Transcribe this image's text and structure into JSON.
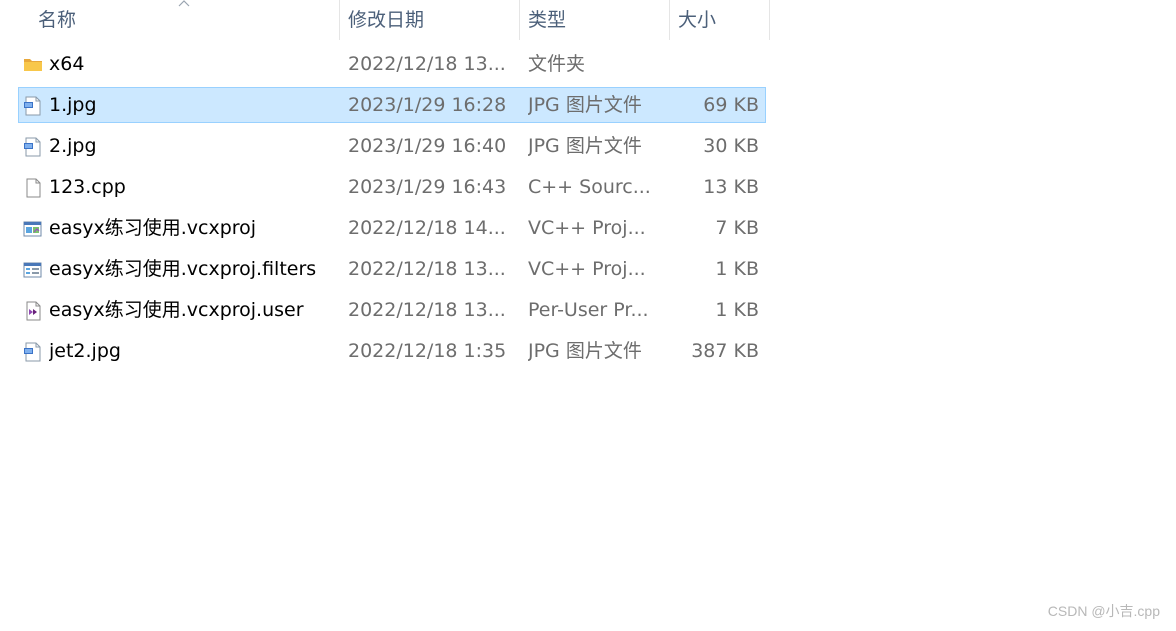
{
  "columns": {
    "name": "名称",
    "date": "修改日期",
    "type": "类型",
    "size": "大小"
  },
  "files": [
    {
      "icon": "folder-icon",
      "name": "x64",
      "date": "2022/12/18 13...",
      "type": "文件夹",
      "size": "",
      "selected": false
    },
    {
      "icon": "jpg-file-icon",
      "name": "1.jpg",
      "date": "2023/1/29 16:28",
      "type": "JPG 图片文件",
      "size": "69 KB",
      "selected": true
    },
    {
      "icon": "jpg-file-icon",
      "name": "2.jpg",
      "date": "2023/1/29 16:40",
      "type": "JPG 图片文件",
      "size": "30 KB",
      "selected": false
    },
    {
      "icon": "blank-file-icon",
      "name": "123.cpp",
      "date": "2023/1/29 16:43",
      "type": "C++ Sourc...",
      "size": "13 KB",
      "selected": false
    },
    {
      "icon": "vcxproj-file-icon",
      "name": "easyx练习使用.vcxproj",
      "date": "2022/12/18 14...",
      "type": "VC++ Proj...",
      "size": "7 KB",
      "selected": false
    },
    {
      "icon": "filters-file-icon",
      "name": "easyx练习使用.vcxproj.filters",
      "date": "2022/12/18 13...",
      "type": "VC++ Proj...",
      "size": "1 KB",
      "selected": false
    },
    {
      "icon": "user-file-icon",
      "name": "easyx练习使用.vcxproj.user",
      "date": "2022/12/18 13...",
      "type": "Per-User Pr...",
      "size": "1 KB",
      "selected": false
    },
    {
      "icon": "jpg-file-icon",
      "name": "jet2.jpg",
      "date": "2022/12/18 1:35",
      "type": "JPG 图片文件",
      "size": "387 KB",
      "selected": false
    }
  ],
  "watermark": "CSDN @小吉.cpp",
  "colors": {
    "selection_bg": "#cce8ff",
    "selection_border": "#99d1ff",
    "header_text": "#4c607a",
    "secondary_text": "#6d6d6d",
    "folder": "#f8c74a"
  }
}
